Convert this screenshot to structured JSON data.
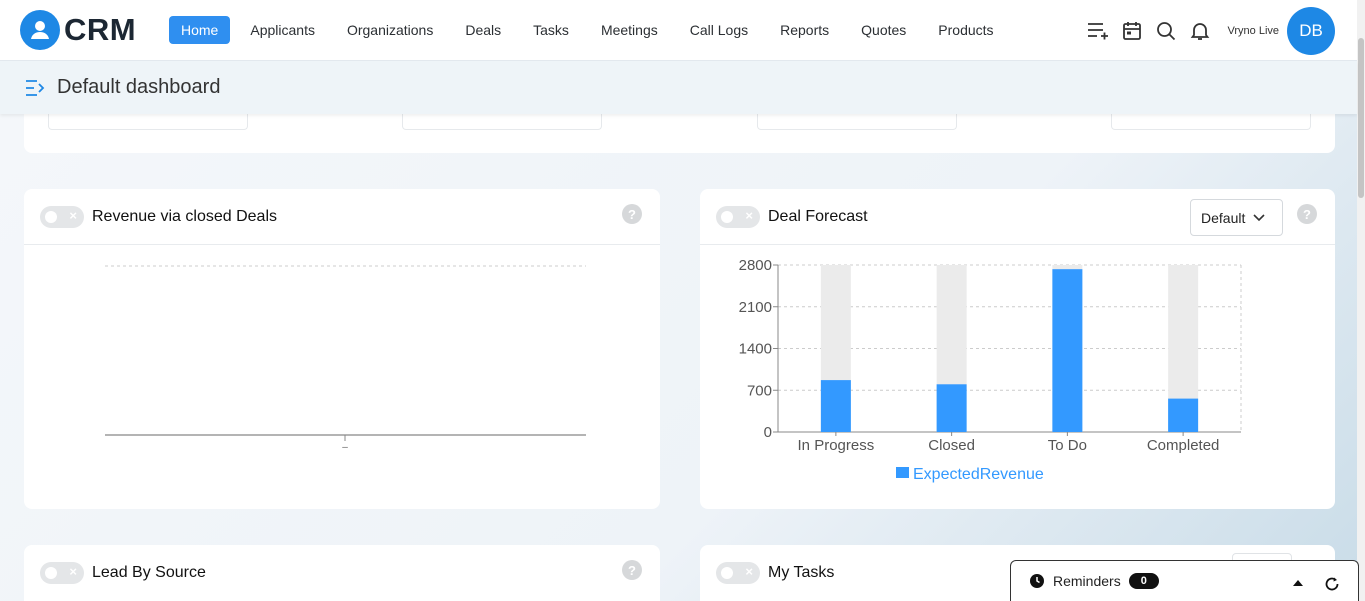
{
  "app": {
    "logo_text": "CRM"
  },
  "nav": {
    "items": [
      {
        "label": "Home",
        "active": true
      },
      {
        "label": "Applicants"
      },
      {
        "label": "Organizations"
      },
      {
        "label": "Deals"
      },
      {
        "label": "Tasks"
      },
      {
        "label": "Meetings"
      },
      {
        "label": "Call Logs"
      },
      {
        "label": "Reports"
      },
      {
        "label": "Quotes"
      },
      {
        "label": "Products"
      }
    ]
  },
  "top_right": {
    "instance_name": "Vryno Live",
    "avatar_initials": "DB"
  },
  "subheader": {
    "title": "Default dashboard"
  },
  "widgets": {
    "revenue": {
      "title": "Revenue via closed Deals",
      "x_tick": "–"
    },
    "forecast": {
      "title": "Deal Forecast",
      "select_value": "Default"
    },
    "lead_source": {
      "title": "Lead By Source"
    },
    "my_tasks": {
      "title": "My Tasks"
    }
  },
  "help_symbol": "?",
  "reminders": {
    "label": "Reminders",
    "count": "0"
  },
  "colors": {
    "accent": "#2f8ff0",
    "bar": "#3399ff",
    "bar_bg": "#ebebeb"
  },
  "chart_data": {
    "type": "bar",
    "categories": [
      "In Progress",
      "Closed",
      "To Do",
      "Completed"
    ],
    "series": [
      {
        "name": "ExpectedRevenue",
        "values": [
          870,
          800,
          2730,
          560
        ]
      }
    ],
    "ylim": [
      0,
      2800
    ],
    "yticks": [
      0,
      700,
      1400,
      2100,
      2800
    ],
    "grid": true,
    "legend": "bottom"
  }
}
